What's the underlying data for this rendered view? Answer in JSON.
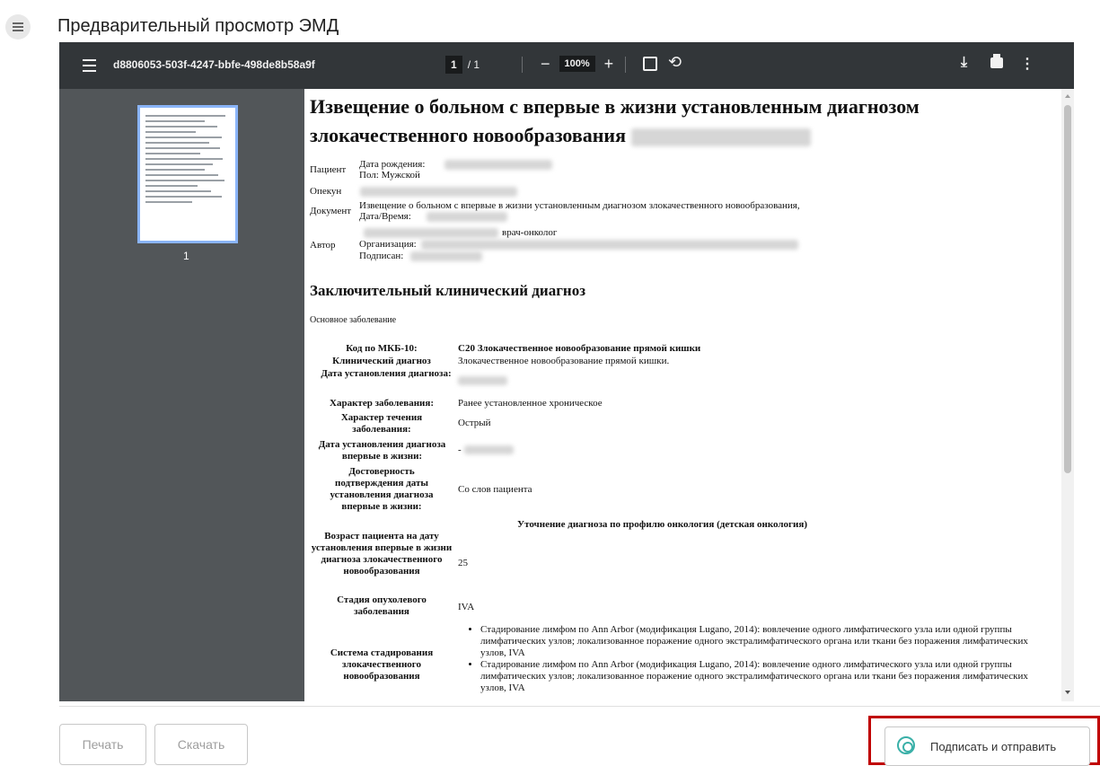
{
  "page": {
    "title": "Предварительный просмотр ЭМД"
  },
  "toolbar": {
    "filename": "d8806053-503f-4247-bbfe-498de8b58a9f",
    "page_current": "1",
    "page_total": "/ 1",
    "zoom": "100%"
  },
  "thumbnail": {
    "page_number": "1"
  },
  "document": {
    "title": "Извещение о больном с впервые в жизни установленным диагнозом злокачественного новообразования",
    "patient_label": "Пациент",
    "dob_label": "Дата рождения:",
    "sex": "Пол: Мужской",
    "guardian_label": "Опекун",
    "doc_label": "Документ",
    "doc_name": "Извещение о больном с впервые в жизни установленным диагнозом злокачественного новообразования,",
    "datetime_label": "Дата/Время:",
    "author_label": "Автор",
    "author_role": "врач-онколог",
    "org_label": "Организация:",
    "signed_label": "Подписан:",
    "section_title": "Заключительный клинический диагноз",
    "section_sub": "Основное заболевание",
    "rows": {
      "mkb_label": "Код по МКБ-10:",
      "mkb_value": "C20 Злокачественное новообразование прямой кишки",
      "clin_label": "Клинический диагноз",
      "clin_value": "Злокачественное новообразование прямой кишки.",
      "date_est_label": "Дата установления диагноза:",
      "char_label": "Характер заболевания:",
      "char_value": "Ранее установленное хроническое",
      "course_label": "Характер течения заболевания:",
      "course_value": "Острый",
      "first_label": "Дата установления диагноза впервые в жизни:",
      "first_prefix": "-",
      "rel_label": "Достоверность подтверждения даты установления диагноза впервые в жизни:",
      "rel_value": "Со слов пациента",
      "onco_heading": "Уточнение диагноза по профилю онкология (детская онкология)",
      "age_label": "Возраст пациента на дату установления впервые в жизни диагноза злокачественного новообразования",
      "age_value": "25",
      "stage_label": "Стадия опухолевого заболевания",
      "stage_value": "IVA",
      "system_label": "Система стадирования злокачественного новообразования"
    },
    "bullets": [
      "Стадирование лимфом по Ann Arbor (модификация Lugano, 2014): вовлечение одного лимфатического узла или одной группы лимфатических узлов; локализованное поражение одного экстралимфатического органа или ткани без поражения лимфатических узлов, IVA",
      "Стадирование лимфом по Ann Arbor (модификация Lugano, 2014): вовлечение одного лимфатического узла или одной группы лимфатических узлов; локализованное поражение одного экстралимфатического органа или ткани без поражения лимфатических узлов, IVA"
    ]
  },
  "footer": {
    "print_label": "Печать",
    "download_label": "Скачать",
    "sign_label": "Подписать и отправить"
  }
}
